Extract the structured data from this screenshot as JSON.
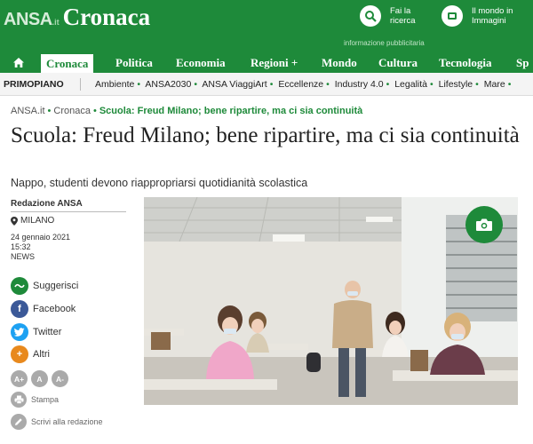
{
  "header": {
    "logo_brand": "ANSA",
    "logo_tld": ".it",
    "section": "Cronaca",
    "search_label_1": "Fai la",
    "search_label_2": "ricerca",
    "world_label_1": "Il mondo in",
    "world_label_2": "Immagini",
    "ad_label": "informazione pubblicitaria"
  },
  "nav": {
    "items": [
      "Cronaca",
      "Politica",
      "Economia",
      "Regioni +",
      "Mondo",
      "Cultura",
      "Tecnologia",
      "Sp"
    ]
  },
  "subnav": {
    "primo": "PRIMOPIANO",
    "links": [
      "Ambiente",
      "ANSA2030",
      "ANSA ViaggiArt",
      "Eccellenze",
      "Industry 4.0",
      "Legalità",
      "Lifestyle",
      "Mare"
    ]
  },
  "breadcrumb": {
    "root": "ANSA.it",
    "section": "Cronaca",
    "current": "Scuola: Freud Milano; bene ripartire, ma ci sia continuità"
  },
  "article": {
    "title": "Scuola: Freud Milano; bene ripartire, ma ci sia continuità",
    "subtitle": "Nappo, studenti devono riappropriarsi quotidianità scolastica",
    "author": "Redazione ANSA",
    "location": "MILANO",
    "date": "24 gennaio 2021",
    "time": "15:32",
    "category": "NEWS"
  },
  "share": {
    "suggest": "Suggerisci",
    "facebook": "Facebook",
    "twitter": "Twitter",
    "others": "Altri"
  },
  "tools": {
    "font_plus": "A+",
    "font_normal": "A",
    "font_minus": "A-",
    "print": "Stampa",
    "write": "Scrivi alla redazione"
  },
  "colors": {
    "brand_green": "#1e8a3a",
    "facebook": "#3b5998",
    "twitter": "#1da1f2",
    "others": "#e8891d"
  }
}
